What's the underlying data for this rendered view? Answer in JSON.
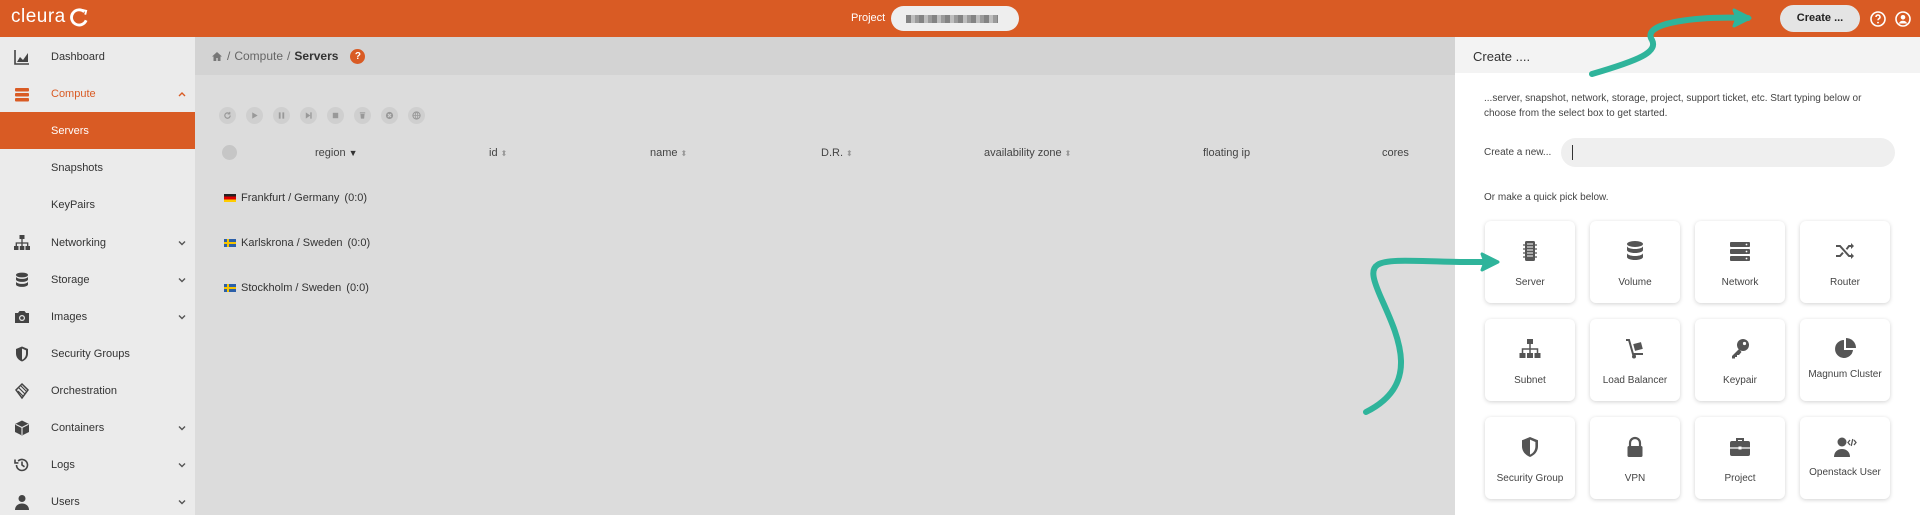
{
  "header": {
    "logo_text": "cleura",
    "project_label": "Project",
    "create_label": "Create ...",
    "accent_color": "#d95b24"
  },
  "sidebar": {
    "items": [
      {
        "label": "Dashboard",
        "icon": "chart-area-icon"
      },
      {
        "label": "Compute",
        "icon": "server-stack-icon"
      },
      {
        "label": "Servers"
      },
      {
        "label": "Snapshots"
      },
      {
        "label": "KeyPairs"
      },
      {
        "label": "Networking",
        "icon": "sitemap-icon"
      },
      {
        "label": "Storage",
        "icon": "database-icon"
      },
      {
        "label": "Images",
        "icon": "camera-icon"
      },
      {
        "label": "Security Groups",
        "icon": "shield-icon"
      },
      {
        "label": "Orchestration",
        "icon": "layers-icon"
      },
      {
        "label": "Containers",
        "icon": "cube-icon"
      },
      {
        "label": "Logs",
        "icon": "history-icon"
      },
      {
        "label": "Users",
        "icon": "user-icon"
      }
    ]
  },
  "breadcrumb": {
    "sep1": "/",
    "compute": "Compute",
    "sep2": "/",
    "current": "Servers",
    "help": "?"
  },
  "table": {
    "columns": [
      "region",
      "id",
      "name",
      "D.R.",
      "availability zone",
      "floating ip",
      "cores"
    ],
    "rows": [
      {
        "region": "Frankfurt / Germany",
        "count": "(0:0)"
      },
      {
        "region": "Karlskrona / Sweden",
        "count": "(0:0)"
      },
      {
        "region": "Stockholm / Sweden",
        "count": "(0:0)"
      }
    ]
  },
  "panel": {
    "title": "Create ....",
    "description": "...server, snapshot, network, storage, project, support ticket, etc. Start typing below or choose from the select box to get started.",
    "create_new_label": "Create a new...",
    "create_new_value": "",
    "quick_pick_label": "Or make a quick pick below.",
    "tiles": [
      {
        "label": "Server",
        "icon": "server-icon"
      },
      {
        "label": "Volume",
        "icon": "database-icon"
      },
      {
        "label": "Network",
        "icon": "network-icon"
      },
      {
        "label": "Router",
        "icon": "shuffle-icon"
      },
      {
        "label": "Subnet",
        "icon": "sitemap-icon"
      },
      {
        "label": "Load Balancer",
        "icon": "dolly-icon"
      },
      {
        "label": "Keypair",
        "icon": "key-icon"
      },
      {
        "label": "Magnum Cluster",
        "icon": "pie-chart-icon"
      },
      {
        "label": "Security Group",
        "icon": "shield-icon"
      },
      {
        "label": "VPN",
        "icon": "lock-icon"
      },
      {
        "label": "Project",
        "icon": "briefcase-icon"
      },
      {
        "label": "Openstack User",
        "icon": "user-code-icon"
      }
    ]
  }
}
